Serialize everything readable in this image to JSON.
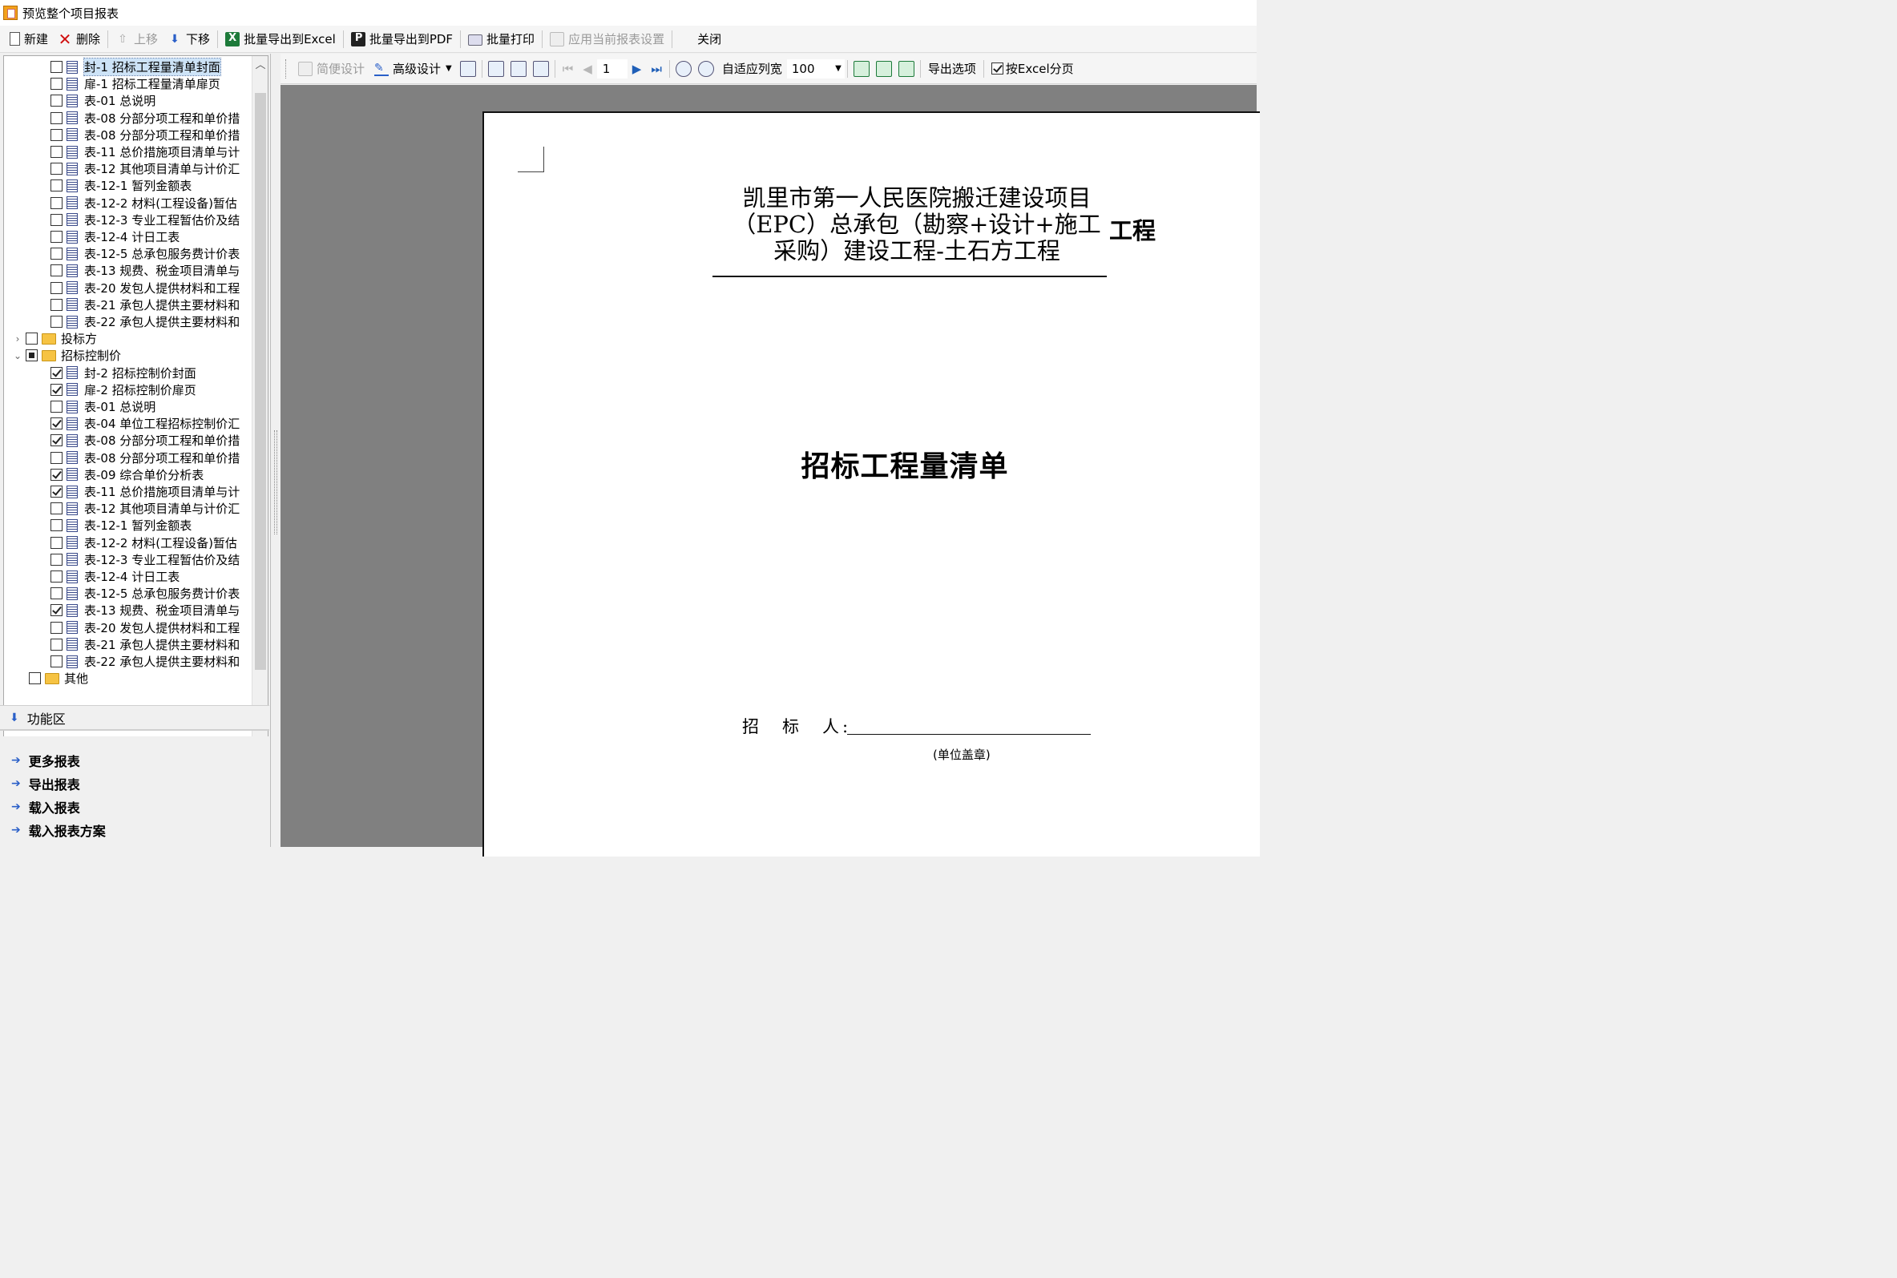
{
  "window": {
    "title": "预览整个项目报表"
  },
  "toolbar": {
    "new_label": "新建",
    "delete_label": "删除",
    "move_up_label": "上移",
    "move_down_label": "下移",
    "export_excel_label": "批量导出到Excel",
    "export_pdf_label": "批量导出到PDF",
    "batch_print_label": "批量打印",
    "apply_settings_label": "应用当前报表设置",
    "close_label": "关闭"
  },
  "tree": {
    "group1_items": [
      {
        "label": "封-1 招标工程量清单封面",
        "checked": false,
        "selected": true
      },
      {
        "label": "扉-1 招标工程量清单扉页",
        "checked": false
      },
      {
        "label": "表-01 总说明",
        "checked": false
      },
      {
        "label": "表-08 分部分项工程和单价措",
        "checked": false
      },
      {
        "label": "表-08 分部分项工程和单价措",
        "checked": false
      },
      {
        "label": "表-11 总价措施项目清单与计",
        "checked": false
      },
      {
        "label": "表-12 其他项目清单与计价汇",
        "checked": false
      },
      {
        "label": "表-12-1 暂列金额表",
        "checked": false
      },
      {
        "label": "表-12-2 材料(工程设备)暂估",
        "checked": false
      },
      {
        "label": "表-12-3 专业工程暂估价及结",
        "checked": false
      },
      {
        "label": "表-12-4 计日工表",
        "checked": false
      },
      {
        "label": "表-12-5 总承包服务费计价表",
        "checked": false
      },
      {
        "label": "表-13 规费、税金项目清单与",
        "checked": false
      },
      {
        "label": "表-20 发包人提供材料和工程",
        "checked": false
      },
      {
        "label": "表-21 承包人提供主要材料和",
        "checked": false
      },
      {
        "label": "表-22 承包人提供主要材料和",
        "checked": false
      }
    ],
    "folder_bidder": {
      "label": "投标方",
      "expanded": false
    },
    "folder_control": {
      "label": "招标控制价",
      "expanded": true
    },
    "group2_items": [
      {
        "label": "封-2 招标控制价封面",
        "checked": true
      },
      {
        "label": "扉-2 招标控制价扉页",
        "checked": true
      },
      {
        "label": "表-01 总说明",
        "checked": false
      },
      {
        "label": "表-04 单位工程招标控制价汇",
        "checked": true
      },
      {
        "label": "表-08 分部分项工程和单价措",
        "checked": true
      },
      {
        "label": "表-08 分部分项工程和单价措",
        "checked": false
      },
      {
        "label": "表-09 综合单价分析表",
        "checked": true
      },
      {
        "label": "表-11 总价措施项目清单与计",
        "checked": true
      },
      {
        "label": "表-12 其他项目清单与计价汇",
        "checked": false
      },
      {
        "label": "表-12-1 暂列金额表",
        "checked": false
      },
      {
        "label": "表-12-2 材料(工程设备)暂估",
        "checked": false
      },
      {
        "label": "表-12-3 专业工程暂估价及结",
        "checked": false
      },
      {
        "label": "表-12-4 计日工表",
        "checked": false
      },
      {
        "label": "表-12-5 总承包服务费计价表",
        "checked": false
      },
      {
        "label": "表-13 规费、税金项目清单与",
        "checked": true
      },
      {
        "label": "表-20 发包人提供材料和工程",
        "checked": false
      },
      {
        "label": "表-21 承包人提供主要材料和",
        "checked": false
      },
      {
        "label": "表-22 承包人提供主要材料和",
        "checked": false
      }
    ],
    "folder_other": {
      "label": "其他",
      "expanded": false
    }
  },
  "function_area": {
    "title": "功能区",
    "links": [
      "更多报表",
      "导出报表",
      "载入报表",
      "载入报表方案"
    ]
  },
  "preview_toolbar": {
    "simple_design_label": "简便设计",
    "advanced_design_label": "高级设计",
    "page_number": "1",
    "fit_width_label": "自适应列宽",
    "zoom_value": "100",
    "export_options_label": "导出选项",
    "excel_paging_label": "按Excel分页",
    "excel_paging_checked": true
  },
  "document": {
    "title_lines": [
      "凯里市第一人民医院搬迁建设项目",
      "（EPC）总承包（勘察+设计+施工",
      "采购）建设工程-土石方工程"
    ],
    "title_suffix": "工程",
    "main_title": "招标工程量清单",
    "bidder_label": "招　标　人:",
    "seal_note": "(单位盖章)"
  }
}
